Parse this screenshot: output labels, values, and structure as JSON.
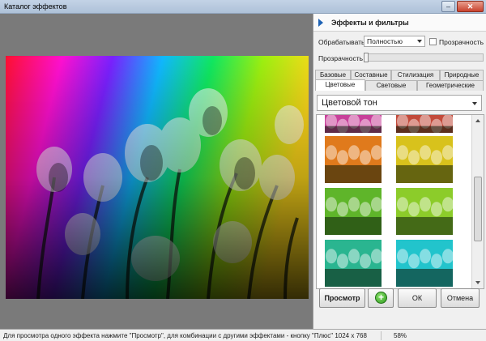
{
  "window": {
    "title": "Каталог эффектов",
    "minimize_glyph": "–",
    "close_glyph": "✕"
  },
  "panel": {
    "title": "Эффекты и фильтры",
    "process_label": "Обрабатывать",
    "process_value": "Полностью",
    "transparency_check_label": "Прозрачность",
    "transparency_slider_label": "Прозрачность",
    "transparency_level": 0
  },
  "tabs": {
    "row1": [
      "Базовые",
      "Составные",
      "Стилизация",
      "Природные"
    ],
    "row2": [
      "Цветовые",
      "Световые",
      "Геометрические"
    ],
    "active": "Цветовые"
  },
  "effect_select": {
    "value": "Цветовой тон"
  },
  "gallery": {
    "icons": [
      "tulip-thumbnail-magenta",
      "tulip-thumbnail-red",
      "tulip-thumbnail-orange",
      "tulip-thumbnail-yellow",
      "tulip-thumbnail-green",
      "tulip-thumbnail-lime",
      "tulip-thumbnail-cyan-teal",
      "tulip-thumbnail-aqua"
    ],
    "colors": [
      "#c8409a",
      "#c24a3a",
      "#e07a1c",
      "#d8c21c",
      "#5fb52a",
      "#8ccc2a",
      "#2ab590",
      "#22c4cc"
    ]
  },
  "buttons": {
    "preview": "Просмотр",
    "plus_glyph": "+",
    "ok": "ОК",
    "cancel": "Отмена"
  },
  "status": {
    "hint": "Для просмотра одного эффекта нажмите \"Просмотр\", для комбинации с другими эффектами - кнопку \"Плюс\"  1024 x 768",
    "zoom": "58%"
  },
  "colors": {
    "accent": "#1f63b5",
    "workspace_bg": "#7a7a7a"
  }
}
